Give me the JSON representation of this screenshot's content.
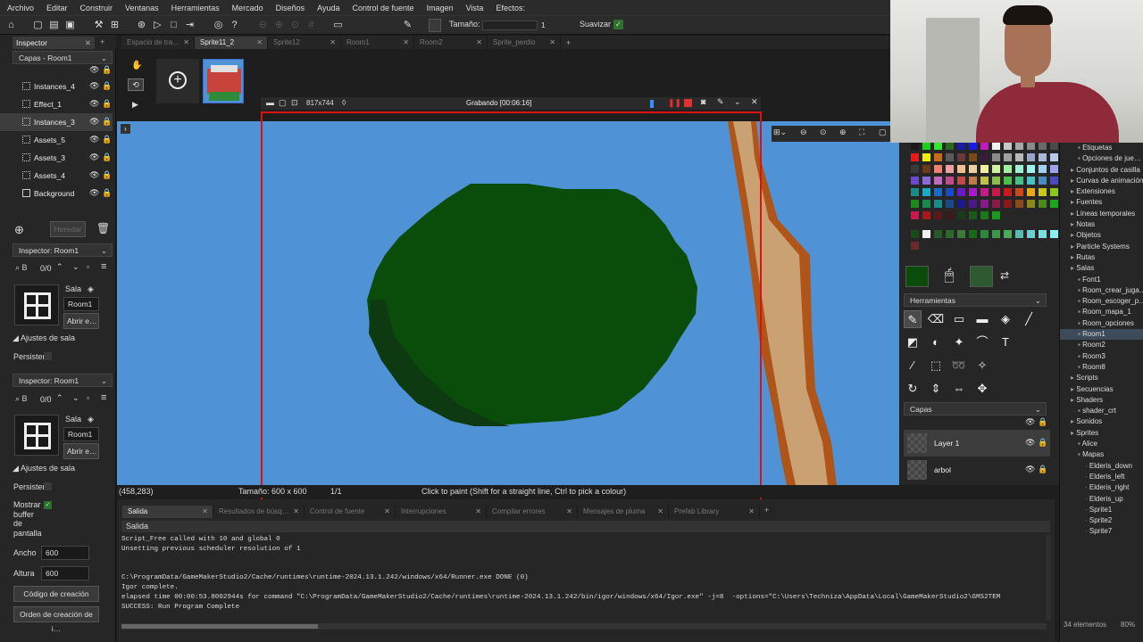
{
  "menu": [
    "Archivo",
    "Editar",
    "Construir",
    "Ventanas",
    "Herramientas",
    "Mercado",
    "Diseños",
    "Ayuda",
    "Control de fuente",
    "Imagen",
    "Vista",
    "Efectos:"
  ],
  "toolbar": {
    "size_label": "Tamaño:",
    "size_value": "1",
    "smooth_label": "Suavizar"
  },
  "editor_tabs": [
    {
      "label": "Espacio de tra…",
      "active": false
    },
    {
      "label": "Sprite11_2",
      "active": true
    },
    {
      "label": "Sprite12",
      "active": false
    },
    {
      "label": "Room1",
      "active": false
    },
    {
      "label": "Room2",
      "active": false
    },
    {
      "label": "Sprite_perdio",
      "active": false
    }
  ],
  "inspector": {
    "tab": "Inspector",
    "layers_title": "Capas - Room1",
    "layers": [
      {
        "name": "Instances_4",
        "icon": "instances"
      },
      {
        "name": "Effect_1",
        "icon": "effect"
      },
      {
        "name": "Instances_3",
        "icon": "instances",
        "selected": true
      },
      {
        "name": "Assets_5",
        "icon": "assets"
      },
      {
        "name": "Assets_3",
        "icon": "assets"
      },
      {
        "name": "Assets_4",
        "icon": "assets"
      },
      {
        "name": "Background",
        "icon": "background"
      }
    ],
    "inherit_label": "Heredar",
    "room_inspector_1": {
      "title": "Inspector: Room1",
      "count": "0/0",
      "sala_label": "Sala",
      "room_name": "Room1",
      "open_label": "Abrir e…",
      "settings_label": "Ajustes de sala",
      "persist_label": "Persister"
    },
    "room_inspector_2": {
      "title": "Inspector: Room1",
      "count": "0/0",
      "sala_label": "Sala",
      "room_name": "Room1",
      "open_label": "Abrir e…",
      "settings_label": "Ajustes de sala",
      "persist_label": "Persister",
      "show_buffer_label": "Mostrar buffer de pantalla",
      "width_label": "Ancho",
      "width_value": "600",
      "height_label": "Altura",
      "height_value": "600",
      "creation_code_label": "Código de creación",
      "creation_order_label": "Orden de creación de i…"
    }
  },
  "recording": {
    "size": "817x744",
    "status": "Grabando [00:06:16]"
  },
  "canvas": {
    "bg": "#4f93d6",
    "tree_dark": "#0a4d0a",
    "tree_shadow": "#0d3a10",
    "trunk": "#c9a173",
    "trunk_edge": "#b0551a"
  },
  "statusbar": {
    "coords": "(458,283)",
    "size": "Tamaño: 600 x 600",
    "frame": "1/1",
    "hint": "Click to paint (Shift for a straight line, Ctrl to pick a colour)"
  },
  "output_tabs": [
    "Salida",
    "Resultados de búsq…",
    "Control de fuente",
    "Interrupciones",
    "Compilar errores",
    "Mensajes de pluma",
    "Prefab Library"
  ],
  "output": {
    "title": "Salida",
    "lines": [
      "Script_Free called with 10 and global 0",
      "Unsetting previous scheduler resolution of 1",
      "",
      "",
      "C:\\ProgramData/GameMakerStudio2/Cache/runtimes\\runtime-2024.13.1.242/windows/x64/Runner.exe DONE (0)",
      "Igor complete.",
      "elapsed time 00:00:53.8002944s for command \"C:\\ProgramData/GameMakerStudio2/Cache/runtimes\\runtime-2024.13.1.242/bin/igor/windows/x64/Igor.exe\" -j=8  -options=\"C:\\Users\\Techniza\\AppData\\Local\\GameMakerStudio2\\GMS2TEM",
      "SUCCESS: Run Program Complete"
    ]
  },
  "tools_panel": {
    "title": "Herramientas",
    "layers_title": "Capas",
    "layers": [
      {
        "name": "Layer 1",
        "selected": true
      },
      {
        "name": "arbol",
        "selected": false
      }
    ]
  },
  "resource_tree": {
    "items": [
      {
        "label": "Etiquetas",
        "indent": 2
      },
      {
        "label": "Opciones de jue…",
        "indent": 2
      },
      {
        "label": "Conjuntos de casilla",
        "indent": 1
      },
      {
        "label": "Curvas de animación",
        "indent": 1
      },
      {
        "label": "Extensiones",
        "indent": 1
      },
      {
        "label": "Fuentes",
        "indent": 1
      },
      {
        "label": "Líneas temporales",
        "indent": 1
      },
      {
        "label": "Notas",
        "indent": 1
      },
      {
        "label": "Objetos",
        "indent": 1
      },
      {
        "label": "Particle Systems",
        "indent": 1
      },
      {
        "label": "Rutas",
        "indent": 1
      },
      {
        "label": "Salas",
        "indent": 1
      },
      {
        "label": "Font1",
        "indent": 2
      },
      {
        "label": "Room_crear_juga…",
        "indent": 2
      },
      {
        "label": "Room_escoger_p…",
        "indent": 2
      },
      {
        "label": "Room_mapa_1",
        "indent": 2
      },
      {
        "label": "Room_opciones",
        "indent": 2
      },
      {
        "label": "Room1",
        "indent": 2,
        "selected": true
      },
      {
        "label": "Room2",
        "indent": 2
      },
      {
        "label": "Room3",
        "indent": 2
      },
      {
        "label": "Room8",
        "indent": 2
      },
      {
        "label": "Scripts",
        "indent": 1
      },
      {
        "label": "Secuencias",
        "indent": 1
      },
      {
        "label": "Shaders",
        "indent": 1
      },
      {
        "label": "shader_crt",
        "indent": 2
      },
      {
        "label": "Sonidos",
        "indent": 1
      },
      {
        "label": "Sprites",
        "indent": 1
      },
      {
        "label": "Alice",
        "indent": 2
      },
      {
        "label": "Mapas",
        "indent": 2
      },
      {
        "label": "Elderis_down",
        "indent": 3
      },
      {
        "label": "Elderis_left",
        "indent": 3
      },
      {
        "label": "Elderis_right",
        "indent": 3
      },
      {
        "label": "Elderis_up",
        "indent": 3
      },
      {
        "label": "Sprite1",
        "indent": 3
      },
      {
        "label": "Sprite2",
        "indent": 3
      },
      {
        "label": "Sprite7",
        "indent": 3
      }
    ],
    "footer": "34 elementos",
    "zoom": "80%"
  }
}
